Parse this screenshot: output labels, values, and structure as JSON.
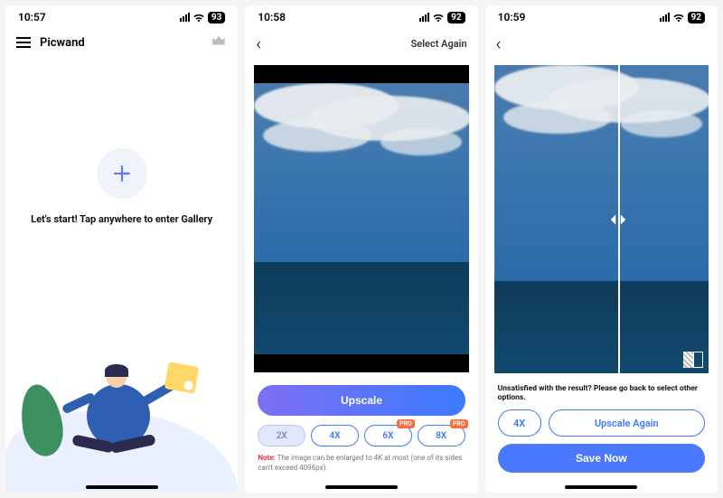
{
  "screens": [
    {
      "status": {
        "time": "10:57",
        "battery": "93"
      },
      "header": {
        "title": "Picwand"
      },
      "start_text": "Let's start! Tap anywhere to enter Gallery"
    },
    {
      "status": {
        "time": "10:58",
        "battery": "92"
      },
      "header": {
        "select_again": "Select Again"
      },
      "upscale_label": "Upscale",
      "scales": {
        "x2": "2X",
        "x4": "4X",
        "x6": "6X",
        "x8": "8X",
        "pro": "PRO"
      },
      "note_label": "Note:",
      "note_text": " The image can be enlarged to 4K at most (one of its sides can't exceed 4096px)."
    },
    {
      "status": {
        "time": "10:59",
        "battery": "92"
      },
      "result_text": "Unsatisfied with the result? Please go back to select other options.",
      "x4_label": "4X",
      "upscale_again": "Upscale Again",
      "save_now": "Save Now"
    }
  ]
}
